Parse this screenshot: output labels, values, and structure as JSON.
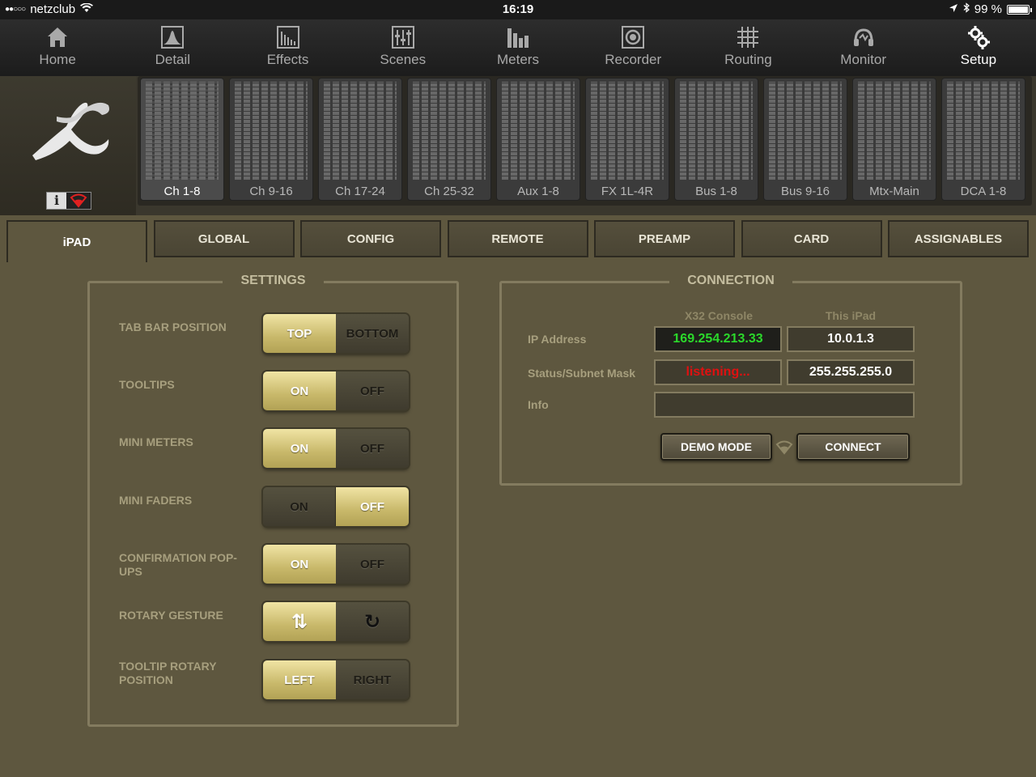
{
  "status_bar": {
    "carrier": "netzclub",
    "time": "16:19",
    "battery": "99 %",
    "battery_level": 0.99
  },
  "nav": [
    {
      "label": "Home",
      "icon": "home-icon"
    },
    {
      "label": "Detail",
      "icon": "detail-icon"
    },
    {
      "label": "Effects",
      "icon": "effects-icon"
    },
    {
      "label": "Scenes",
      "icon": "scenes-icon"
    },
    {
      "label": "Meters",
      "icon": "meters-icon"
    },
    {
      "label": "Recorder",
      "icon": "recorder-icon"
    },
    {
      "label": "Routing",
      "icon": "routing-icon"
    },
    {
      "label": "Monitor",
      "icon": "monitor-icon"
    },
    {
      "label": "Setup",
      "icon": "setup-icon",
      "active": true
    }
  ],
  "banks": [
    {
      "label": "Ch 1-8",
      "active": true
    },
    {
      "label": "Ch 9-16"
    },
    {
      "label": "Ch 17-24"
    },
    {
      "label": "Ch 25-32"
    },
    {
      "label": "Aux 1-8"
    },
    {
      "label": "FX 1L-4R"
    },
    {
      "label": "Bus 1-8"
    },
    {
      "label": "Bus 9-16"
    },
    {
      "label": "Mtx-Main"
    },
    {
      "label": "DCA 1-8"
    }
  ],
  "tabs": [
    {
      "label": "iPAD",
      "active": true
    },
    {
      "label": "GLOBAL"
    },
    {
      "label": "CONFIG"
    },
    {
      "label": "REMOTE"
    },
    {
      "label": "PREAMP"
    },
    {
      "label": "CARD"
    },
    {
      "label": "ASSIGNABLES"
    }
  ],
  "settings": {
    "title": "SETTINGS",
    "rows": [
      {
        "label": "TAB BAR POSITION",
        "left": "TOP",
        "right": "BOTTOM",
        "selected": "left"
      },
      {
        "label": "TOOLTIPS",
        "left": "ON",
        "right": "OFF",
        "selected": "left"
      },
      {
        "label": "MINI METERS",
        "left": "ON",
        "right": "OFF",
        "selected": "left"
      },
      {
        "label": "MINI FADERS",
        "left": "ON",
        "right": "OFF",
        "selected": "right"
      },
      {
        "label": "CONFIRMATION POP-UPS",
        "left": "ON",
        "right": "OFF",
        "selected": "left"
      },
      {
        "label": "ROTARY GESTURE",
        "left": "⇅",
        "right": "↻",
        "selected": "left"
      },
      {
        "label": "TOOLTIP ROTARY POSITION",
        "left": "LEFT",
        "right": "RIGHT",
        "selected": "left"
      }
    ]
  },
  "connection": {
    "title": "CONNECTION",
    "col_console": "X32 Console",
    "col_ipad": "This iPad",
    "ip_label": "IP Address",
    "status_label": "Status/Subnet Mask",
    "info_label": "Info",
    "console_ip": "169.254.213.33",
    "ipad_ip": "10.0.1.3",
    "console_status": "listening...",
    "ipad_subnet": "255.255.255.0",
    "info": "",
    "demo_button": "DEMO MODE",
    "connect_button": "CONNECT",
    "colors": {
      "ip": "#2bd92b",
      "status": "#e01010"
    }
  }
}
